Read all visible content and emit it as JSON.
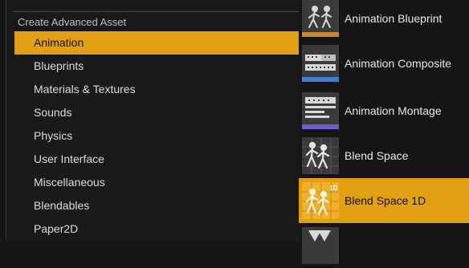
{
  "menu": {
    "section_title": "Create Advanced Asset",
    "categories": [
      {
        "label": "Animation",
        "selected": true
      },
      {
        "label": "Blueprints"
      },
      {
        "label": "Materials & Textures"
      },
      {
        "label": "Sounds"
      },
      {
        "label": "Physics"
      },
      {
        "label": "User Interface"
      },
      {
        "label": "Miscellaneous"
      },
      {
        "label": "Blendables"
      },
      {
        "label": "Paper2D"
      }
    ]
  },
  "submenu": {
    "items": [
      {
        "label": "Animation Blueprint",
        "icon": "animation-blueprint-icon"
      },
      {
        "label": "Animation Composite",
        "icon": "animation-composite-icon"
      },
      {
        "label": "Animation Montage",
        "icon": "animation-montage-icon"
      },
      {
        "label": "Blend Space",
        "icon": "blend-space-icon"
      },
      {
        "label": "Blend Space 1D",
        "icon": "blend-space-1d-icon",
        "selected": true,
        "badge": "1D"
      }
    ]
  },
  "colors": {
    "accent": "#e0a012",
    "background": "#151515",
    "text": "#dcdcdc"
  }
}
